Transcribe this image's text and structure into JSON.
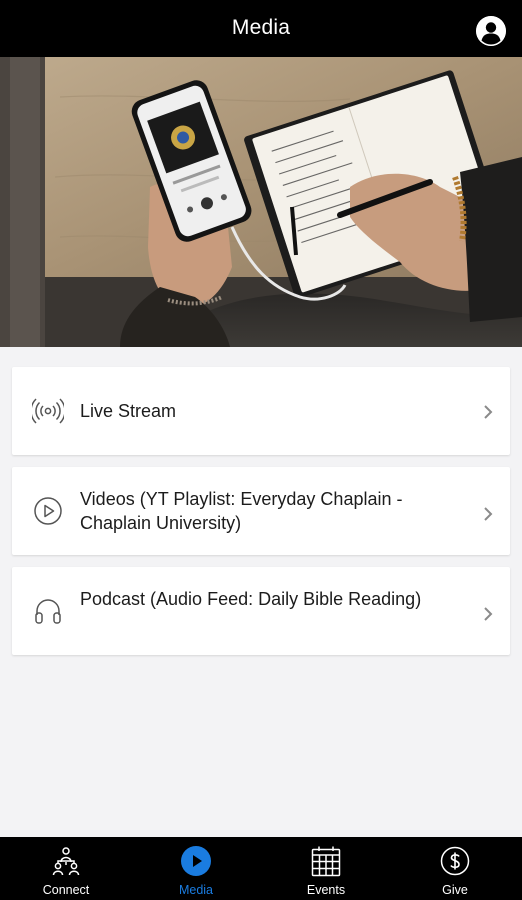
{
  "header": {
    "title": "Media"
  },
  "hero": {
    "description_icon": "photo-phone-notebook"
  },
  "media_items": [
    {
      "icon": "live-stream-icon",
      "label": "Live Stream"
    },
    {
      "icon": "play-circle-icon",
      "label": "Videos (YT Playlist: Everyday Chaplain - Chaplain University)"
    },
    {
      "icon": "headphones-icon",
      "label": "Podcast (Audio Feed: Daily Bible Reading)"
    }
  ],
  "tabbar": {
    "tabs": [
      {
        "icon": "connect-icon",
        "label": "Connect",
        "active": false
      },
      {
        "icon": "media-play-icon",
        "label": "Media",
        "active": true
      },
      {
        "icon": "calendar-icon",
        "label": "Events",
        "active": false
      },
      {
        "icon": "dollar-icon",
        "label": "Give",
        "active": false
      }
    ]
  },
  "colors": {
    "header_bg": "#000000",
    "tabbar_bg": "#000000",
    "accent": "#1a7ce0",
    "page_bg": "#f3f3f5",
    "card_bg": "#ffffff"
  }
}
